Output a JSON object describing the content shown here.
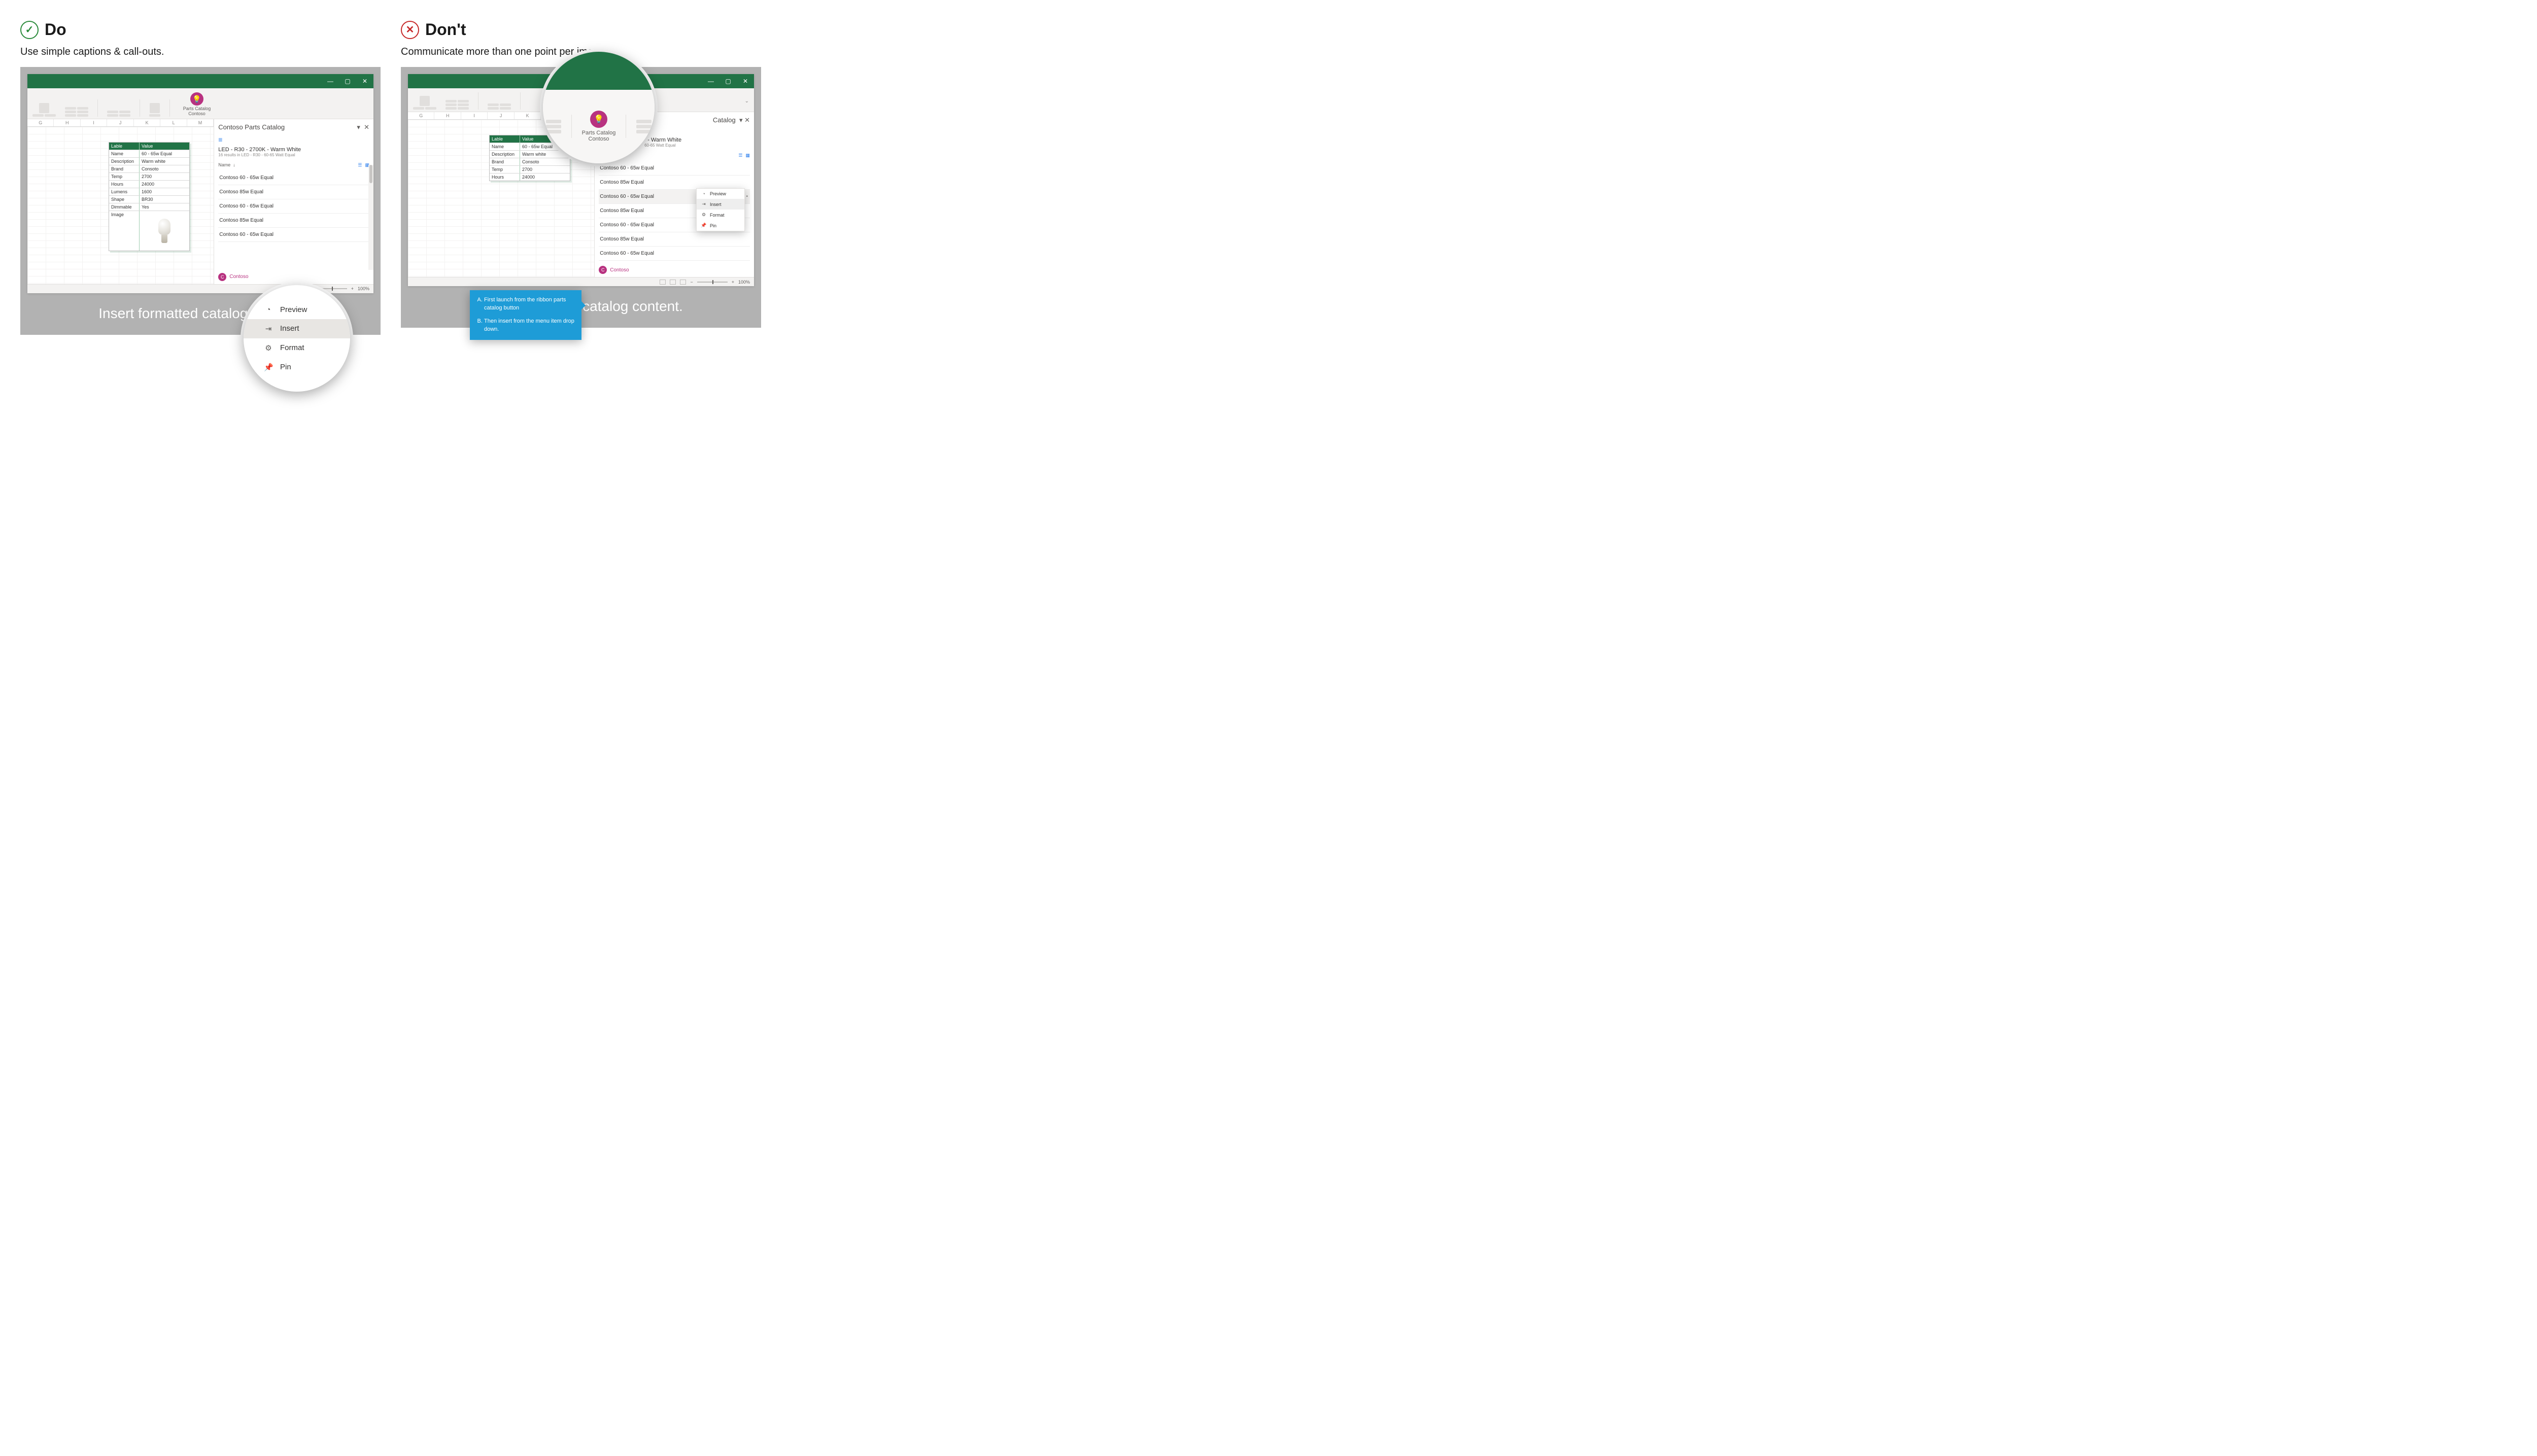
{
  "do": {
    "heading": "Do",
    "subtitle": "Use simple captions & call-outs.",
    "caption": "Insert formatted catalog content.",
    "lens_menu": {
      "preview": "Preview",
      "insert": "Insert",
      "format": "Format",
      "pin": "Pin"
    }
  },
  "dont": {
    "heading": "Don't",
    "subtitle": "Communicate more than one point per image.",
    "caption": "Insert formatted catalog content.",
    "lens_ribbon": {
      "app_name": "Parts Catalog",
      "vendor": "Contoso"
    },
    "callout": {
      "a": "First launch from the ribbon parts catalog button",
      "b": "Then insert from the menu item drop down."
    },
    "ctx": {
      "preview": "Preview",
      "insert": "Insert",
      "format": "Format",
      "pin": "Pin"
    }
  },
  "common": {
    "ribbon_app_line1": "Parts Catalog",
    "ribbon_app_line2": "Contoso",
    "pane_title": "Contoso Parts Catalog",
    "pane_subtitle": "LED - R30 - 2700K - Warm White",
    "pane_meta": "16 results in LED - R30 - 60-65 Watt Equal",
    "sort_label": "Name",
    "sort_arrow": "↓",
    "list": [
      "Contoso 60 - 65w Equal",
      "Contoso 85w Equal",
      "Contoso 60 - 65w Equal",
      "Contoso 85w Equal",
      "Contoso 60 - 65w Equal",
      "Contoso 85w Equal",
      "Contoso 60 - 65w Equal"
    ],
    "footer": {
      "initial": "C",
      "name": "Contoso"
    },
    "zoom": "100%",
    "columns": [
      "G",
      "H",
      "I",
      "J",
      "K",
      "L",
      "M"
    ],
    "table": {
      "head": [
        "Lable",
        "Value"
      ],
      "rows": [
        [
          "Name",
          "60 - 65w Equal"
        ],
        [
          "Description",
          "Warm white"
        ],
        [
          "Brand",
          "Consoto"
        ],
        [
          "Temp",
          "2700"
        ],
        [
          "Hours",
          "24000"
        ],
        [
          "Lumens",
          "1600"
        ],
        [
          "Shape",
          "BR30"
        ],
        [
          "Dimmable",
          "Yes"
        ],
        [
          "Image",
          ""
        ]
      ]
    }
  }
}
